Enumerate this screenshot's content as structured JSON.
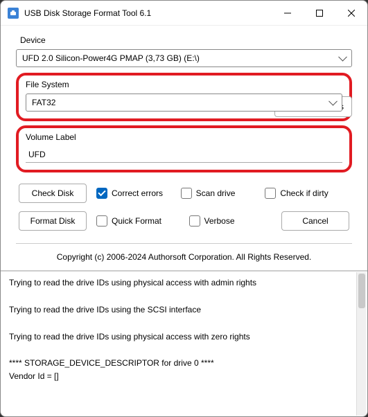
{
  "window": {
    "title": "USB Disk Storage Format Tool 6.1"
  },
  "labels": {
    "device": "Device",
    "file_system": "File System",
    "volume_label": "Volume Label"
  },
  "device": {
    "selected": "UFD 2.0  Silicon-Power4G  PMAP (3,73 GB) (E:\\)"
  },
  "file_system": {
    "selected": "FAT32"
  },
  "volume_label": {
    "value": "UFD"
  },
  "buttons": {
    "refresh": "Refresh Devices",
    "check_disk": "Check Disk",
    "format_disk": "Format Disk",
    "cancel": "Cancel"
  },
  "checkboxes": {
    "correct_errors": "Correct errors",
    "scan_drive": "Scan drive",
    "check_if_dirty": "Check if dirty",
    "quick_format": "Quick Format",
    "verbose": "Verbose"
  },
  "copyright": "Copyright (c) 2006-2024 Authorsoft Corporation. All Rights Reserved.",
  "log": {
    "lines": [
      "Trying to read the drive IDs using physical access with admin rights",
      "Trying to read the drive IDs using the SCSI interface",
      "Trying to read the drive IDs using physical access with zero rights",
      "**** STORAGE_DEVICE_DESCRIPTOR for drive 0 ****",
      "Vendor Id = []"
    ]
  }
}
